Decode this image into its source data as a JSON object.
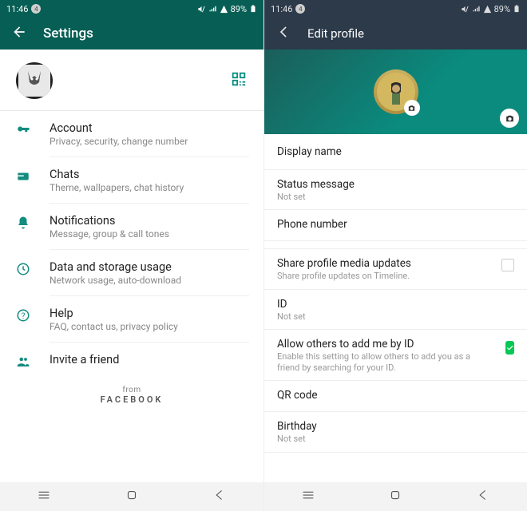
{
  "status": {
    "time": "11:46",
    "battery": "89%"
  },
  "left": {
    "title": "Settings",
    "items": [
      {
        "icon": "key-icon",
        "title": "Account",
        "sub": "Privacy, security, change number"
      },
      {
        "icon": "chat-icon",
        "title": "Chats",
        "sub": "Theme, wallpapers, chat history"
      },
      {
        "icon": "bell-icon",
        "title": "Notifications",
        "sub": "Message, group & call tones"
      },
      {
        "icon": "data-icon",
        "title": "Data and storage usage",
        "sub": "Network usage, auto-download"
      },
      {
        "icon": "help-icon",
        "title": "Help",
        "sub": "FAQ, contact us, privacy policy"
      },
      {
        "icon": "invite-icon",
        "title": "Invite a friend",
        "sub": ""
      }
    ],
    "from": "from",
    "brand": "FACEBOOK"
  },
  "right": {
    "title": "Edit profile",
    "display_name": "Display name",
    "status_msg": "Status message",
    "not_set": "Not set",
    "phone": "Phone number",
    "share_media": "Share profile media updates",
    "share_media_sub": "Share profile updates on Timeline.",
    "id": "ID",
    "allow_by_id": "Allow others to add me by ID",
    "allow_by_id_sub": "Enable this setting to allow others to add you as a friend by searching for your ID.",
    "qr": "QR code",
    "birthday": "Birthday"
  }
}
